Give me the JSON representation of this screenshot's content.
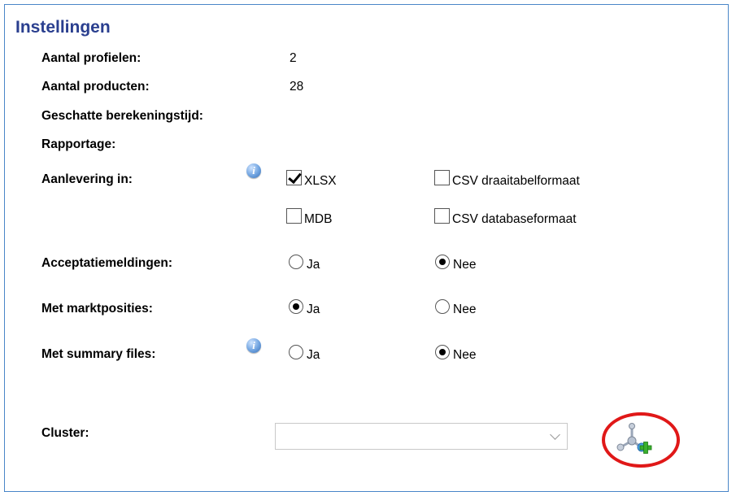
{
  "title": "Instellingen",
  "summary": {
    "profiles_label": "Aantal profielen:",
    "profiles_value": "2",
    "products_label": "Aantal producten:",
    "products_value": "28",
    "time_label": "Geschatte berekeningstijd:",
    "report_label": "Rapportage:"
  },
  "delivery": {
    "label": "Aanlevering in:",
    "info_icon": "info-icon",
    "options": [
      {
        "label": "XLSX",
        "checked": true
      },
      {
        "label": "CSV draaitabelformaat",
        "checked": false
      },
      {
        "label": "MDB",
        "checked": false
      },
      {
        "label": "CSV databaseformaat",
        "checked": false
      }
    ]
  },
  "acceptance": {
    "label": "Acceptatiemeldingen:",
    "yes": "Ja",
    "no": "Nee",
    "selected": "Nee"
  },
  "market": {
    "label": "Met marktposities:",
    "yes": "Ja",
    "no": "Nee",
    "selected": "Ja"
  },
  "summary_files": {
    "label": "Met summary files:",
    "info_icon": "info-icon",
    "yes": "Ja",
    "no": "Nee",
    "selected": "Nee"
  },
  "cluster": {
    "label": "Cluster:",
    "value": "",
    "add_icon": "add-cluster-icon"
  },
  "colors": {
    "title": "#2a3f8f",
    "border": "#4a86c8",
    "highlight": "#e01818"
  }
}
